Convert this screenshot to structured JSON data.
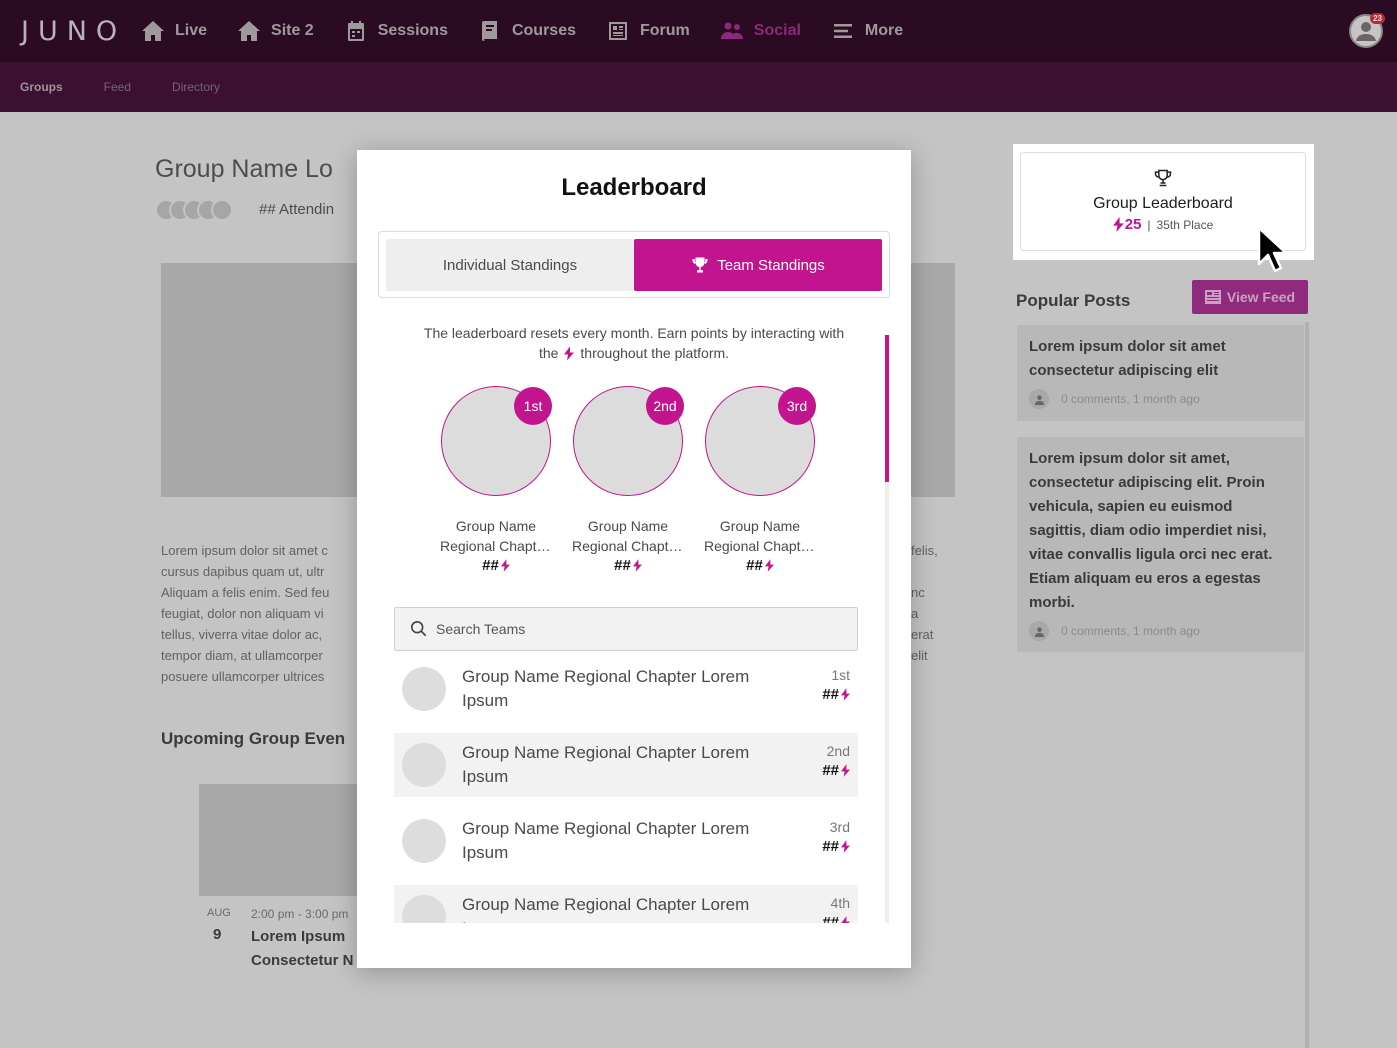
{
  "brand": {
    "logo": "JUNO",
    "accent": "#c2148f",
    "nav_bg": "#2a0b22"
  },
  "topnav": {
    "items": [
      {
        "label": "Live",
        "icon": "home-icon"
      },
      {
        "label": "Site 2",
        "icon": "home-icon"
      },
      {
        "label": "Sessions",
        "icon": "calendar-icon"
      },
      {
        "label": "Courses",
        "icon": "book-icon"
      },
      {
        "label": "Forum",
        "icon": "forum-icon"
      },
      {
        "label": "Social",
        "icon": "people-icon",
        "active": true
      },
      {
        "label": "More",
        "icon": "menu-icon"
      }
    ],
    "notification_count": "23"
  },
  "subnav": {
    "items": [
      "Groups",
      "Feed",
      "Directory"
    ],
    "active": "Groups"
  },
  "background": {
    "title": "Group Name Lo",
    "attending": "## Attendin",
    "paragraph_lines": [
      "Lorem ipsum dolor sit amet c",
      "cursus dapibus quam ut, ultr",
      "Aliquam a felis enim. Sed feu",
      "feugiat, dolor non aliquam vi",
      "tellus, viverra vitae dolor ac,",
      "tempor diam, at ullamcorper",
      "posuere ullamcorper ultrices"
    ],
    "paragraph_right_lines": [
      "felis,",
      "",
      "nc",
      "a",
      "erat",
      "elit",
      ""
    ],
    "upcoming_title": "Upcoming Group Even",
    "event": {
      "month": "AUG",
      "day": "9",
      "time": "2:00 pm - 3:00 pm",
      "title_lines": [
        "Lorem Ipsum",
        "Consectetur N"
      ]
    }
  },
  "sidebar": {
    "leaderboard_card": {
      "title": "Group Leaderboard",
      "points": "25",
      "place": "35th Place",
      "icon": "trophy-icon"
    },
    "popular_posts": {
      "title": "Popular Posts",
      "view_feed_label": "View Feed",
      "posts": [
        {
          "text": "Lorem ipsum dolor sit amet consectetur adipiscing elit",
          "meta": "0 comments, 1 month ago"
        },
        {
          "text": "Lorem ipsum dolor sit amet, consectetur adipiscing elit. Proin vehicula, sapien eu euismod sagittis, diam odio imperdiet nisi, vitae convallis ligula orci nec erat. Etiam aliquam eu eros a egestas morbi.",
          "meta": "0 comments, 1 month ago"
        }
      ]
    }
  },
  "modal": {
    "title": "Leaderboard",
    "tabs": {
      "individual": "Individual Standings",
      "team": "Team Standings",
      "active": "team"
    },
    "intro_before": "The leaderboard resets every month. Earn points by interacting with the",
    "intro_after": "throughout the platform.",
    "podium": [
      {
        "rank": "1st",
        "name_line1": "Group Name",
        "name_line2": "Regional Chapter Lorem Ipsum",
        "score": "##"
      },
      {
        "rank": "2nd",
        "name_line1": "Group Name",
        "name_line2": "Regional Chapter Lorem Ipsum",
        "score": "##"
      },
      {
        "rank": "3rd",
        "name_line1": "Group Name",
        "name_line2": "Regional Chapter Lorem Ipsum",
        "score": "##"
      }
    ],
    "search_placeholder": "Search Teams",
    "rows": [
      {
        "name": "Group Name Regional Chapter Lorem Ipsum",
        "rank": "1st",
        "score": "##"
      },
      {
        "name": "Group Name Regional Chapter Lorem Ipsum",
        "rank": "2nd",
        "score": "##"
      },
      {
        "name": "Group Name Regional Chapter Lorem Ipsum",
        "rank": "3rd",
        "score": "##"
      },
      {
        "name": "Group Name Regional Chapter Lorem Ipsum",
        "rank": "4th",
        "score": "##"
      }
    ]
  }
}
